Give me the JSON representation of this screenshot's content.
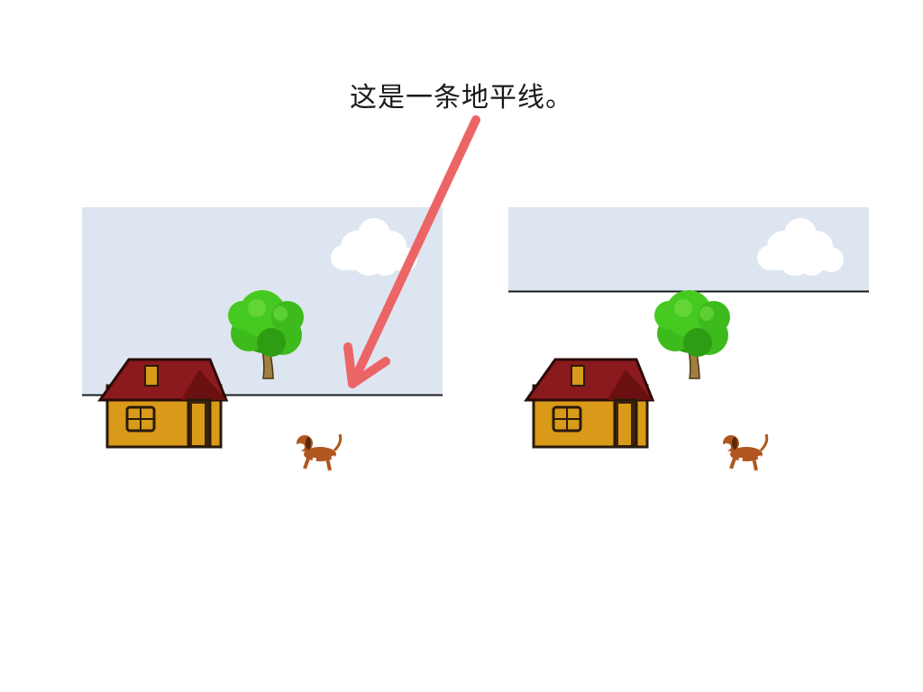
{
  "caption": "这是一条地平线。",
  "colors": {
    "sky": "#dde5f0",
    "horizon_line": "#1a1a1a",
    "arrow": "#ec6566",
    "cloud": "#ffffff",
    "house_wall": "#d99a19",
    "house_roof": "#8a1a1d",
    "tree_leaves": "#3dbb1c",
    "tree_trunk": "#a08040",
    "dog_body": "#b0561e"
  },
  "scenes": [
    {
      "id": "left",
      "sky_extends_to_horizon": true
    },
    {
      "id": "right",
      "sky_extends_to_horizon": false
    }
  ],
  "icons": {
    "arrow": "arrow-icon",
    "cloud": "cloud-icon",
    "house": "house-icon",
    "tree": "tree-icon",
    "dog": "dog-icon"
  }
}
